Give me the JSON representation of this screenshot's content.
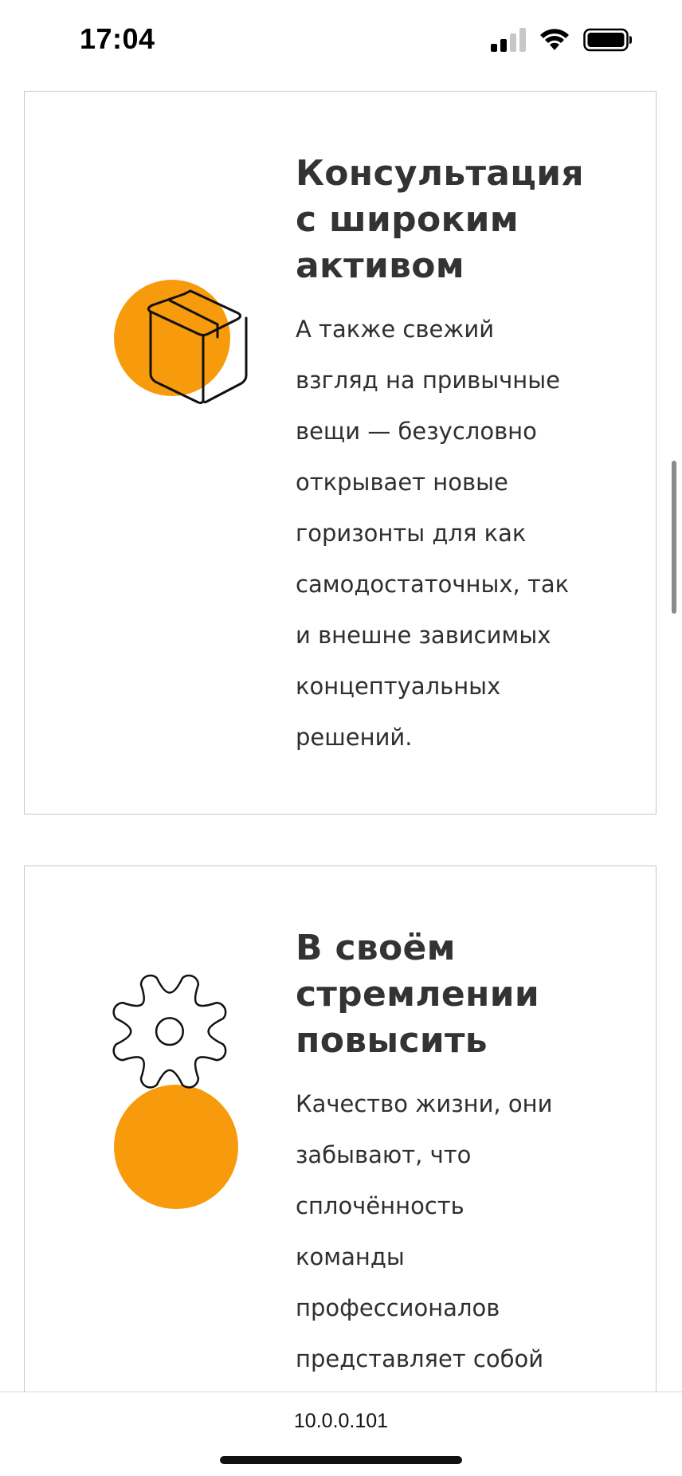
{
  "status_bar": {
    "time": "17:04",
    "icons": [
      "signal-icon",
      "wifi-icon",
      "battery-icon"
    ]
  },
  "colors": {
    "accent": "#f79a0b",
    "text": "#2f2f2f",
    "border": "#c9c9c9"
  },
  "cards": [
    {
      "icon": "box-icon",
      "title": "Консультация\nс широким\nактивом",
      "body": "А также свежий\nвзгляд на привычные\nвещи — безусловно\nоткрывает новые\nгоризонты для как\nсамодостаточных, так\nи внешне зависимых\nконцептуальных\nрешений."
    },
    {
      "icon": "gear-icon",
      "title": "В своём\nстремлении\nповысить",
      "body": "Качество жизни, они\nзабывают, что\nсплочённость\nкоманды\nпрофессионалов\nпредставляет собой"
    }
  ],
  "browser": {
    "url": "10.0.0.101"
  }
}
